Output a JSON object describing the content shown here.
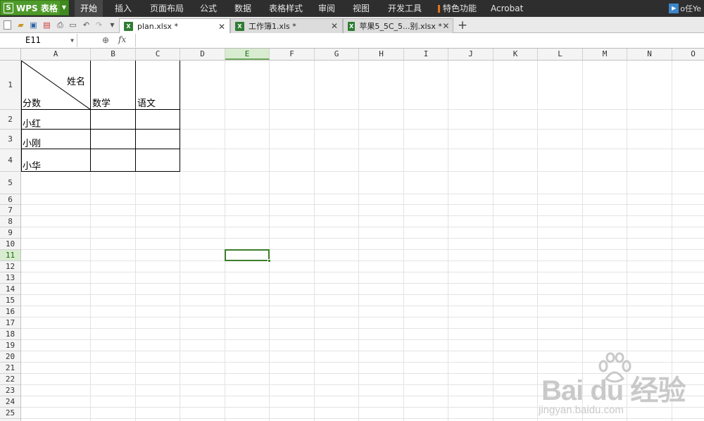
{
  "app": {
    "title": "WPS 表格",
    "logo_letter": "S"
  },
  "menu": [
    {
      "label": "开始",
      "active": true
    },
    {
      "label": "插入"
    },
    {
      "label": "页面布局"
    },
    {
      "label": "公式"
    },
    {
      "label": "数据"
    },
    {
      "label": "表格样式"
    },
    {
      "label": "审阅"
    },
    {
      "label": "视图"
    },
    {
      "label": "开发工具"
    },
    {
      "label": "特色功能"
    },
    {
      "label": "Acrobat"
    }
  ],
  "user": {
    "name": "o任Ye"
  },
  "tabs": [
    {
      "label": "plan.xlsx *",
      "active": true
    },
    {
      "label": "工作簿1.xls *"
    },
    {
      "label": "苹果5_5C_5...别.xlsx *"
    }
  ],
  "formula_bar": {
    "name_box": "E11",
    "fx": "fx",
    "value": ""
  },
  "sheet": {
    "columns": [
      "A",
      "B",
      "C",
      "D",
      "E",
      "F",
      "G",
      "H",
      "I",
      "J",
      "K",
      "L",
      "M",
      "N",
      "O"
    ],
    "rows": [
      "1",
      "2",
      "3",
      "4",
      "5",
      "6",
      "7",
      "8",
      "9",
      "10",
      "11",
      "12",
      "13",
      "14",
      "15",
      "16",
      "17",
      "18",
      "19",
      "20",
      "21",
      "22",
      "23",
      "24",
      "25"
    ],
    "selected_cell": "E11",
    "selected_column": "E",
    "selected_row": "11",
    "cells": {
      "A1_top": "姓名",
      "A1_bottom": "分数",
      "B1": "数学",
      "C1": "语文",
      "A2": "小红",
      "A3": "小刚",
      "A4": "小华"
    }
  },
  "watermark": {
    "brand": "Bai du 经验",
    "url": "jingyan.baidu.com"
  },
  "colors": {
    "menu_bg": "#2e2e2e",
    "app_green": "#4e9a2a",
    "selection": "#3c7d2a"
  }
}
